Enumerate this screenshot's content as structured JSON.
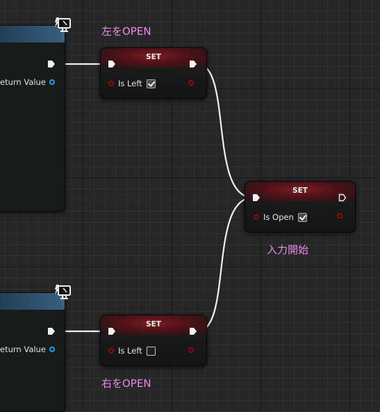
{
  "left_nodes": [
    {
      "pin_label": "eturn Value"
    },
    {
      "pin_label": "eturn Value"
    }
  ],
  "set_nodes": {
    "left_open": {
      "title": "SET",
      "var_label": "Is Left",
      "checked": true
    },
    "set_open": {
      "title": "SET",
      "var_label": "Is Open",
      "checked": true
    },
    "right_open": {
      "title": "SET",
      "var_label": "Is Left",
      "checked": false
    }
  },
  "comments": {
    "left_open": "左をOPEN",
    "input_start": "入力開始",
    "right_open": "右をOPEN"
  },
  "icons": {
    "pure_function": "monitor-lightning-icon",
    "exec_pin": "exec-arrow-icon",
    "bool_pin": "circle-pin-icon"
  },
  "colors": {
    "comment": "#e88be6",
    "set_header": "#7a1e24",
    "object_pin": "#1aa5ea",
    "bool_pin": "#8c0d0d",
    "wire": "#ffffff"
  }
}
